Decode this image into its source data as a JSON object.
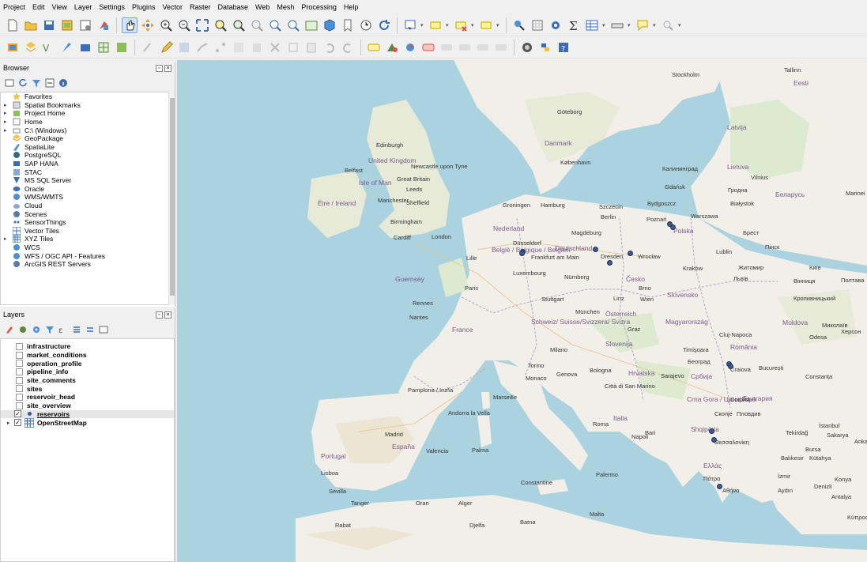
{
  "menu": [
    "Project",
    "Edit",
    "View",
    "Layer",
    "Settings",
    "Plugins",
    "Vector",
    "Raster",
    "Database",
    "Web",
    "Mesh",
    "Processing",
    "Help"
  ],
  "browser": {
    "title": "Browser",
    "items": [
      {
        "label": "Favorites",
        "icon": "star-icon",
        "arrow": ""
      },
      {
        "label": "Spatial Bookmarks",
        "icon": "bookmark-icon",
        "arrow": "▸"
      },
      {
        "label": "Project Home",
        "icon": "project-home-icon",
        "arrow": "▸"
      },
      {
        "label": "Home",
        "icon": "home-icon",
        "arrow": "▸"
      },
      {
        "label": "C:\\ (Windows)",
        "icon": "drive-icon",
        "arrow": "▸"
      },
      {
        "label": "GeoPackage",
        "icon": "geopackage-icon",
        "arrow": ""
      },
      {
        "label": "SpatiaLite",
        "icon": "spatialite-icon",
        "arrow": ""
      },
      {
        "label": "PostgreSQL",
        "icon": "postgresql-icon",
        "arrow": ""
      },
      {
        "label": "SAP HANA",
        "icon": "sap-hana-icon",
        "arrow": ""
      },
      {
        "label": "STAC",
        "icon": "stac-icon",
        "arrow": ""
      },
      {
        "label": "MS SQL Server",
        "icon": "mssql-icon",
        "arrow": ""
      },
      {
        "label": "Oracle",
        "icon": "oracle-icon",
        "arrow": ""
      },
      {
        "label": "WMS/WMTS",
        "icon": "wms-icon",
        "arrow": ""
      },
      {
        "label": "Cloud",
        "icon": "cloud-icon",
        "arrow": ""
      },
      {
        "label": "Scenes",
        "icon": "scenes-icon",
        "arrow": ""
      },
      {
        "label": "SensorThings",
        "icon": "sensorthings-icon",
        "arrow": ""
      },
      {
        "label": "Vector Tiles",
        "icon": "vector-tiles-icon",
        "arrow": ""
      },
      {
        "label": "XYZ Tiles",
        "icon": "xyz-tiles-icon",
        "arrow": "▸"
      },
      {
        "label": "WCS",
        "icon": "wcs-icon",
        "arrow": ""
      },
      {
        "label": "WFS / OGC API - Features",
        "icon": "wfs-icon",
        "arrow": ""
      },
      {
        "label": "ArcGIS REST Servers",
        "icon": "arcgis-icon",
        "arrow": ""
      }
    ]
  },
  "layers": {
    "title": "Layers",
    "items": [
      {
        "label": "infrastructure",
        "checked": false
      },
      {
        "label": "market_conditions",
        "checked": false
      },
      {
        "label": "operation_profile",
        "checked": false
      },
      {
        "label": "pipeline_info",
        "checked": false
      },
      {
        "label": "site_comments",
        "checked": false
      },
      {
        "label": "sites",
        "checked": false
      },
      {
        "label": "reservoir_head",
        "checked": false
      },
      {
        "label": "site_overview",
        "checked": false
      },
      {
        "label": "reservoirs",
        "checked": true
      },
      {
        "label": "OpenStreetMap",
        "checked": true
      }
    ]
  },
  "map": {
    "marker_color": "#3d5a8f",
    "labels": {
      "stockholm": "Stockholm",
      "tallinn": "Tallinn",
      "eesti": "Eesti",
      "goteborg": "Göteborg",
      "latvija": "Latvija",
      "edinburgh": "Edinburgh",
      "danmark": "Danmark",
      "kobenhavn": "København",
      "united_kingdom": "United Kingdom",
      "newcastle": "Newcastle upon Tyne",
      "belfast": "Belfast",
      "great_britain": "Great Britain",
      "isle_of_man": "Isle of Man",
      "leeds": "Leeds",
      "lietuva": "Lietuva",
      "vilnius": "Vilnius",
      "kaliningrad": "Калининград",
      "gdansk": "Gdańsk",
      "eire": "Éire / Ireland",
      "manchester": "Manchester",
      "sheffield": "Sheffield",
      "groningen": "Groningen",
      "hamburg": "Hamburg",
      "szczecin": "Szczecin",
      "bydgoszcz": "Bydgoszcz",
      "belarus": "Беларусь",
      "birmingham": "Birmingham",
      "berlin": "Berlin",
      "poznan": "Poznań",
      "warszawa": "Warszawa",
      "polska": "Polska",
      "nederland": "Nederland",
      "cardiff": "Cardiff",
      "london": "London",
      "magdeburg": "Magdeburg",
      "brest": "Брест",
      "dusseldorf": "Düsseldorf",
      "deutschland": "Deutschland",
      "belgie": "België / Belgique / Belgien",
      "frankfurt": "Frankfurt am Main",
      "dresden": "Dresden",
      "wroclaw": "Wrocław",
      "lublin": "Lublin",
      "lille": "Lille",
      "krakow": "Kraków",
      "guernsey": "Guernsey",
      "luxembourg": "Luxembourg",
      "paris": "Paris",
      "nurnberg": "Nürnberg",
      "cesko": "Česko",
      "brno": "Brno",
      "lviv": "Львів",
      "stuttgart": "Stuttgart",
      "linz": "Linz",
      "wien": "Wien",
      "slovensko": "Slovensko",
      "rennes": "Rennes",
      "munchen": "München",
      "osterreich": "Österreich",
      "nantes": "Nantes",
      "france": "France",
      "schweiz": "Schweiz/ Suisse/Svizzera/ Svizra",
      "graz": "Graz",
      "magyarorszag": "Magyarország",
      "moldova": "Moldova",
      "cluj": "Cluj-Napoca",
      "romania": "România",
      "slovenija": "Slovenija",
      "timisoara": "Timişoara",
      "beograd": "Београд",
      "milano": "Milano",
      "torino": "Torino",
      "genova": "Genova",
      "bologna": "Bologna",
      "hrvatska": "Hrvatska",
      "sarajevo": "Sarajevo",
      "srbija": "Србија",
      "craiova": "Craiova",
      "bucuresti": "București",
      "constanta": "Constanța",
      "monaco": "Monaco",
      "marseille": "Marseille",
      "pamplona": "Pamplona / Iruña",
      "san_marino": "Città di San Marino",
      "crna_gora": "Crna Gora / Црна Гора",
      "sofia": "София",
      "bulgaria": "България",
      "andorra": "Andorra la Vella",
      "roma": "Roma",
      "italia": "Italia",
      "skopje": "Скопје",
      "plovdiv": "Пловдив",
      "madrid": "Madrid",
      "napoli": "Napoli",
      "bari": "Bari",
      "shqiperia": "Shqipëria",
      "istanbul": "İstanbul",
      "espana": "España",
      "valencia": "Valencia",
      "palma": "Palma",
      "thessaloniki": "Θεσσαλονίκη",
      "tekirdag": "Tekirdağ",
      "sakarya": "Sakarya",
      "ankara": "Ankara",
      "portugal": "Portugal",
      "lisboa": "Lisboa",
      "palermo": "Palermo",
      "ellas": "Ελλάς",
      "patra": "Πάτρα",
      "athina": "Αθήνα",
      "izmir": "İzmir",
      "aydin": "Aydın",
      "denizli": "Denizli",
      "antalya": "Antalya",
      "sevilla": "Sevilla",
      "constantine": "Constantine",
      "tanger": "Tanger",
      "oran": "Oran",
      "alger": "Alger",
      "malta": "Malta",
      "rabat": "Rabat",
      "djelfa": "Djelfa",
      "batna": "Batna",
      "kypros": "Κύπρος / Kıbrıs",
      "bursa": "Bursa",
      "balikesir": "Balıkesir",
      "kutahya": "Kütahya",
      "konya": "Konya",
      "chisinau": "Odesa",
      "mykolaiv": "Миколаїв",
      "kherson": "Херсон",
      "poltava": "Полтава",
      "kropyvnytskyi": "Кропивницький",
      "vinnytsia": "Вінниця",
      "zhytomyr": "Житомир",
      "kyiv": "Київ",
      "minsk": "Гродна",
      "bialystok": "Białystok",
      "marinei": "Marinei",
      "pinsk": "Пінск"
    }
  }
}
